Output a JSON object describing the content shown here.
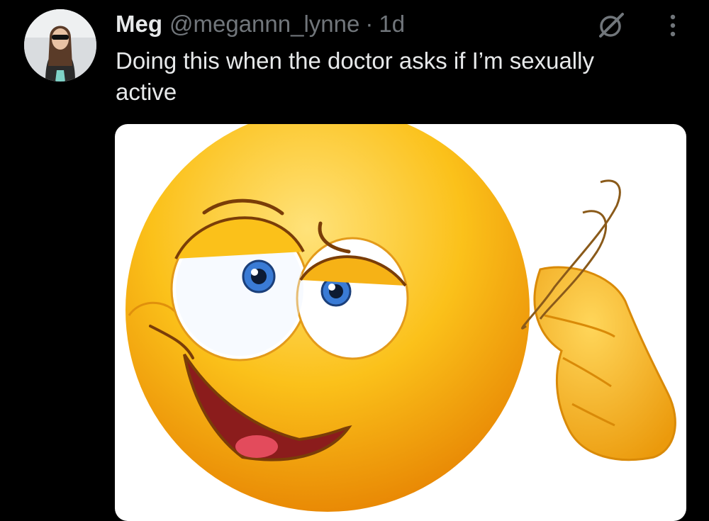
{
  "tweet": {
    "author_name": "Meg",
    "handle": "@megannn_lynne",
    "separator": "·",
    "time": "1d",
    "text": "Doing this when the doctor asks if I’m sexually active"
  },
  "icons": {
    "grok": "grok-icon",
    "more": "more-vertical-icon"
  },
  "colors": {
    "background": "#000000",
    "primary_text": "#e7e9ea",
    "secondary_text": "#71767b",
    "emoji_yellow": "#f7b514"
  }
}
